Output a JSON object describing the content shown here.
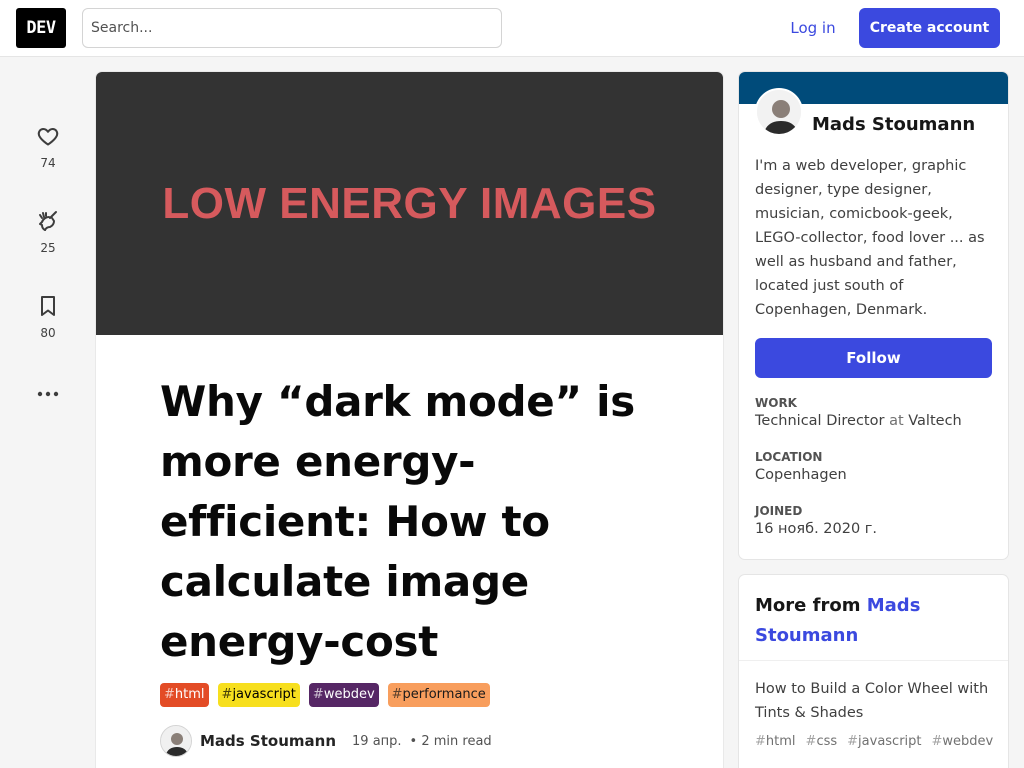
{
  "header": {
    "logo": "DEV",
    "search_placeholder": "Search...",
    "login": "Log in",
    "create_account": "Create account"
  },
  "rail": {
    "hearts": "74",
    "unicorns": "25",
    "bookmarks": "80"
  },
  "article": {
    "cover_text": "LOW ENERGY IMAGES",
    "title": "Why “dark mode” is more energy-efficient: How to calculate image energy-cost",
    "tags": [
      {
        "hash": "#",
        "name": "html",
        "bg": "#e34c26",
        "fg": "#ffffff"
      },
      {
        "hash": "#",
        "name": "javascript",
        "bg": "#f7df1e",
        "fg": "#000000"
      },
      {
        "hash": "#",
        "name": "webdev",
        "bg": "#562765",
        "fg": "#ffffff"
      },
      {
        "hash": "#",
        "name": "performance",
        "bg": "#f89e5d",
        "fg": "#1a1a1a"
      }
    ],
    "author": "Mads Stoumann",
    "date": "19 апр.",
    "read_time": "• 2 min read"
  },
  "profile": {
    "name": "Mads Stoumann",
    "bio": "I'm a web developer, graphic designer, type designer, musician, comicbook-geek, LEGO-collector, food lover ... as well as husband and father, located just south of Copenhagen, Denmark.",
    "follow": "Follow",
    "work_label": "Work",
    "work_title": "Technical Director",
    "work_at": "at",
    "work_company": "Valtech",
    "location_label": "Location",
    "location": "Copenhagen",
    "joined_label": "Joined",
    "joined": "16 нояб. 2020 г."
  },
  "more_from": {
    "prefix": "More from",
    "author": "Mads Stoumann",
    "post_title": "How to Build a Color Wheel with Tints & Shades",
    "post_tags": [
      {
        "hash": "#",
        "name": "html"
      },
      {
        "hash": "#",
        "name": "css"
      },
      {
        "hash": "#",
        "name": "javascript"
      },
      {
        "hash": "#",
        "name": "webdev"
      }
    ]
  },
  "colors": {
    "accent": "#3b49df",
    "profile_banner": "#004b7a",
    "cover_bg": "#333333",
    "cover_text": "#d65a5d"
  }
}
